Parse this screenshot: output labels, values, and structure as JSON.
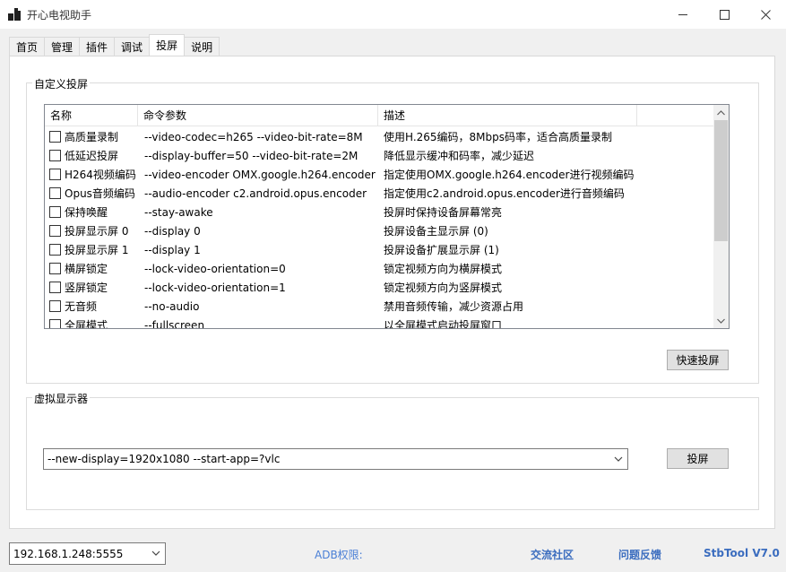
{
  "window": {
    "title": "开心电视助手"
  },
  "tabs": [
    {
      "label": "首页"
    },
    {
      "label": "管理"
    },
    {
      "label": "插件"
    },
    {
      "label": "调试"
    },
    {
      "label": "投屏"
    },
    {
      "label": "说明"
    }
  ],
  "active_tab": "投屏",
  "custom_cast": {
    "group_title": "自定义投屏",
    "columns": [
      "名称",
      "命令参数",
      "描述"
    ],
    "rows": [
      {
        "name": "高质量录制",
        "args": "--video-codec=h265 --video-bit-rate=8M",
        "desc": "使用H.265编码，8Mbps码率，适合高质量录制"
      },
      {
        "name": "低延迟投屏",
        "args": "--display-buffer=50 --video-bit-rate=2M",
        "desc": "降低显示缓冲和码率，减少延迟"
      },
      {
        "name": "H264视频编码",
        "args": "--video-encoder OMX.google.h264.encoder",
        "desc": "指定使用OMX.google.h264.encoder进行视频编码"
      },
      {
        "name": "Opus音频编码",
        "args": "--audio-encoder c2.android.opus.encoder",
        "desc": "指定使用c2.android.opus.encoder进行音频编码"
      },
      {
        "name": "保持唤醒",
        "args": "--stay-awake",
        "desc": "投屏时保持设备屏幕常亮"
      },
      {
        "name": "投屏显示屏 0",
        "args": "--display 0",
        "desc": "投屏设备主显示屏 (0)"
      },
      {
        "name": "投屏显示屏 1",
        "args": "--display 1",
        "desc": "投屏设备扩展显示屏 (1)"
      },
      {
        "name": "横屏锁定",
        "args": "--lock-video-orientation=0",
        "desc": "锁定视频方向为横屏模式"
      },
      {
        "name": "竖屏锁定",
        "args": "--lock-video-orientation=1",
        "desc": "锁定视频方向为竖屏模式"
      },
      {
        "name": "无音频",
        "args": "--no-audio",
        "desc": "禁用音频传输，减少资源占用"
      },
      {
        "name": "全屏模式",
        "args": "--fullscreen",
        "desc": "以全屏模式启动投屏窗口"
      }
    ],
    "quick_cast_label": "快速投屏"
  },
  "virtual_display": {
    "group_title": "虚拟显示器",
    "command_value": "--new-display=1920x1080 --start-app=?vlc",
    "cast_label": "投屏"
  },
  "status": {
    "device": "192.168.1.248:5555",
    "adb_label": "ADB权限:",
    "community_link": "交流社区",
    "feedback_link": "问题反馈",
    "version": "StbTool V7.0"
  },
  "icons": {
    "minimize": "minimize-icon",
    "maximize": "maximize-icon",
    "close": "close-icon",
    "dropdown": "chevron-down-icon"
  },
  "colors": {
    "link": "#3b6dbf",
    "accent": "#4a7fd6"
  }
}
